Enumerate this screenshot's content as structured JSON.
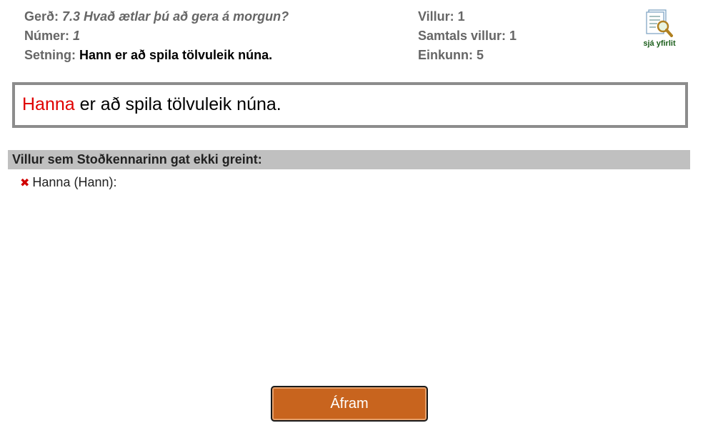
{
  "info_left": {
    "type_label": "Gerð:",
    "type_value": "7.3 Hvað ætlar þú að gera á morgun?",
    "number_label": "Númer:",
    "number_value": "1",
    "sentence_label": "Setning:",
    "sentence_value": "Hann er að spila tölvuleik núna."
  },
  "info_right": {
    "errors": "Villur: 1",
    "total_errors": "Samtals villur: 1",
    "grade": "Einkunn: 5"
  },
  "overview": {
    "label": "sjá yfirlit",
    "icon": "document-magnifier-icon"
  },
  "answer": {
    "wrong_word": "Hanna",
    "rest": " er að spila tölvuleik núna."
  },
  "section": {
    "title": "Villur sem Stoðkennarinn gat ekki greint:"
  },
  "errors_list": [
    {
      "icon": "red-x-icon",
      "text": "Hanna (Hann):"
    }
  ],
  "continue_button": {
    "label": "Áfram"
  },
  "colors": {
    "error_red": "#e00000",
    "button_orange": "#c8641e",
    "header_gray": "#c0c0c0",
    "border_gray": "#8c8c8c"
  }
}
